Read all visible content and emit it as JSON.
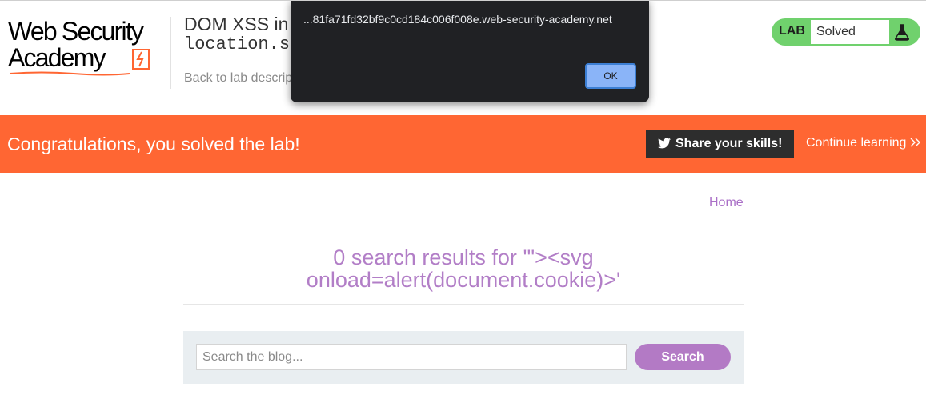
{
  "header": {
    "logo_line1": "Web Security",
    "logo_line2": "Academy",
    "lab_title": "DOM XSS in",
    "lab_title_code": "location.s",
    "back_link": "Back to lab descrip",
    "lab_badge": {
      "label": "LAB",
      "status": "Solved"
    }
  },
  "dialog": {
    "message": "...81fa71fd32bf9c0cd184c006f008e.web-security-academy.net",
    "ok_label": "OK"
  },
  "banner": {
    "message": "Congratulations, you solved the lab!",
    "share_label": "Share your skills!",
    "continue_label": "Continue learning"
  },
  "main": {
    "home_link": "Home",
    "results_line1": "0 search results for '\"><svg",
    "results_line2": "onload=alert(document.cookie)>'",
    "search_placeholder": "Search the blog...",
    "search_button": "Search"
  },
  "colors": {
    "banner": "#ff6633",
    "lab_badge": "#70d16d",
    "accent_purple": "#b27ec7",
    "dialog_bg": "#202124",
    "dialog_button": "#8ab4f8"
  },
  "icons": [
    "logo-bolt-icon",
    "flask-icon",
    "twitter-icon",
    "double-chevron-right-icon"
  ]
}
